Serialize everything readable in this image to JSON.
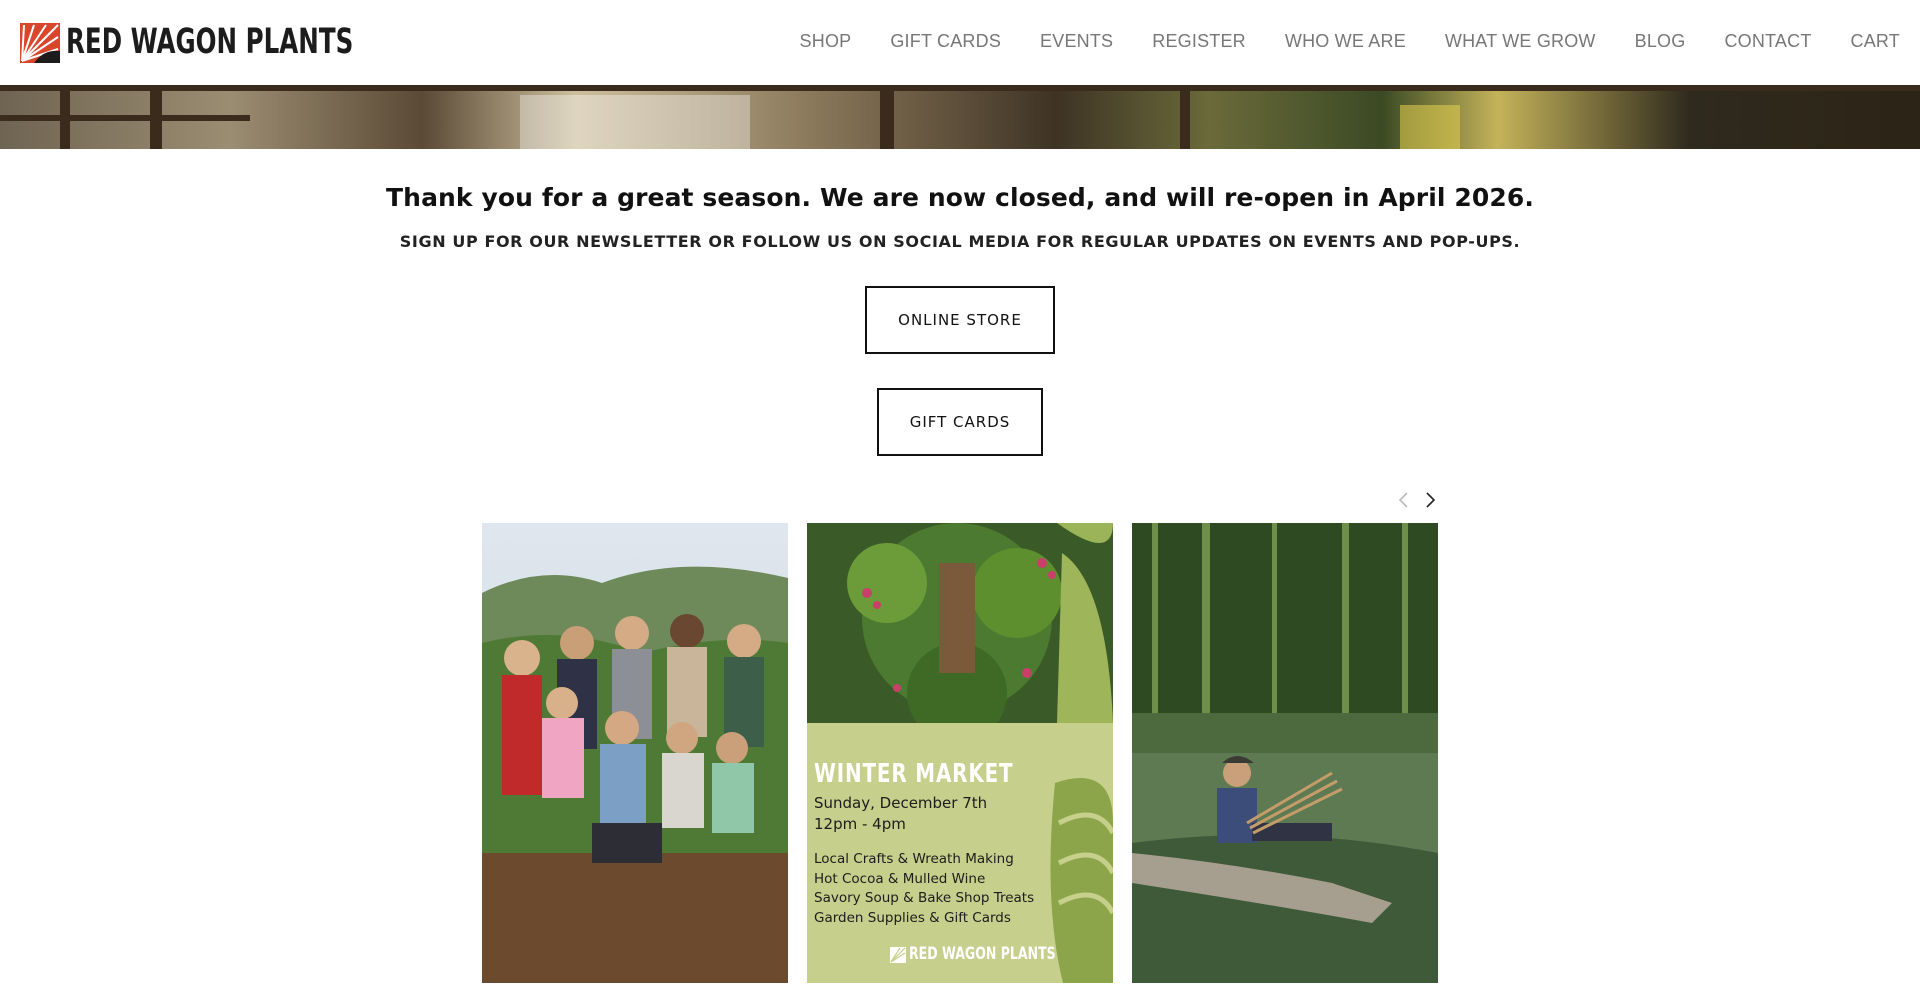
{
  "header": {
    "logo_text": "RED WAGON PLANTS",
    "nav": [
      "SHOP",
      "GIFT CARDS",
      "EVENTS",
      "REGISTER",
      "WHO WE ARE",
      "WHAT WE GROW",
      "BLOG",
      "CONTACT",
      "CART"
    ]
  },
  "notice": {
    "headline": "Thank you for a great season. We are now closed, and will re-open in April 2026.",
    "subline": "SIGN UP FOR OUR NEWSLETTER OR FOLLOW US ON SOCIAL MEDIA FOR REGULAR UPDATES ON EVENTS AND POP-UPS."
  },
  "buttons": {
    "online_store": "ONLINE STORE",
    "gift_cards": "GIFT CARDS"
  },
  "carousel": {
    "prev_icon": "chevron-left-icon",
    "next_icon": "chevron-right-icon",
    "poster": {
      "title": "WINTER MARKET",
      "date": "Sunday, December 7th",
      "time": "12pm - 4pm",
      "items": [
        "Local Crafts & Wreath Making",
        "Hot Cocoa & Mulled Wine",
        "Savory Soup & Bake Shop Treats",
        "Garden Supplies & Gift Cards"
      ],
      "brand": "RED WAGON PLANTS"
    }
  },
  "colors": {
    "brand_red": "#d9462b",
    "poster_green": "#c6cf8b",
    "nav_gray": "#777777"
  }
}
